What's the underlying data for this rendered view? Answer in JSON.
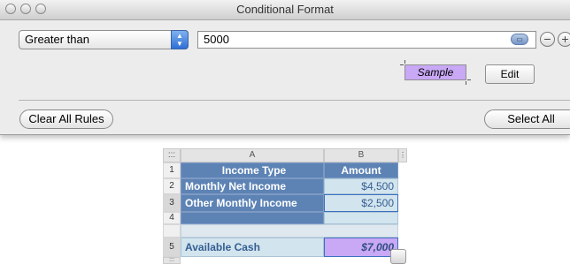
{
  "window": {
    "title": "Conditional Format"
  },
  "rule": {
    "condition": "Greater than",
    "value": "5000",
    "sample_label": "Sample",
    "edit_label": "Edit"
  },
  "buttons": {
    "clear_all": "Clear All Rules",
    "select_all": "Select All"
  },
  "sheet": {
    "corner": ":::",
    "columns": [
      "A",
      "B"
    ],
    "rows": [
      {
        "num": "1",
        "a": "Income Type",
        "b": "Amount"
      },
      {
        "num": "2",
        "a": "Monthly Net Income",
        "b": "$4,500"
      },
      {
        "num": "3",
        "a": "Other Monthly Income",
        "b": "$2,500"
      },
      {
        "num": "4",
        "a": "",
        "b": ""
      },
      {
        "num": "5",
        "a": "Available Cash",
        "b": "$7,000"
      }
    ],
    "more_rows": ":::"
  },
  "colors": {
    "sample_fill": "#c9a8f5",
    "header_fill": "#5d83b5",
    "value_fill": "#d2e4ed"
  }
}
